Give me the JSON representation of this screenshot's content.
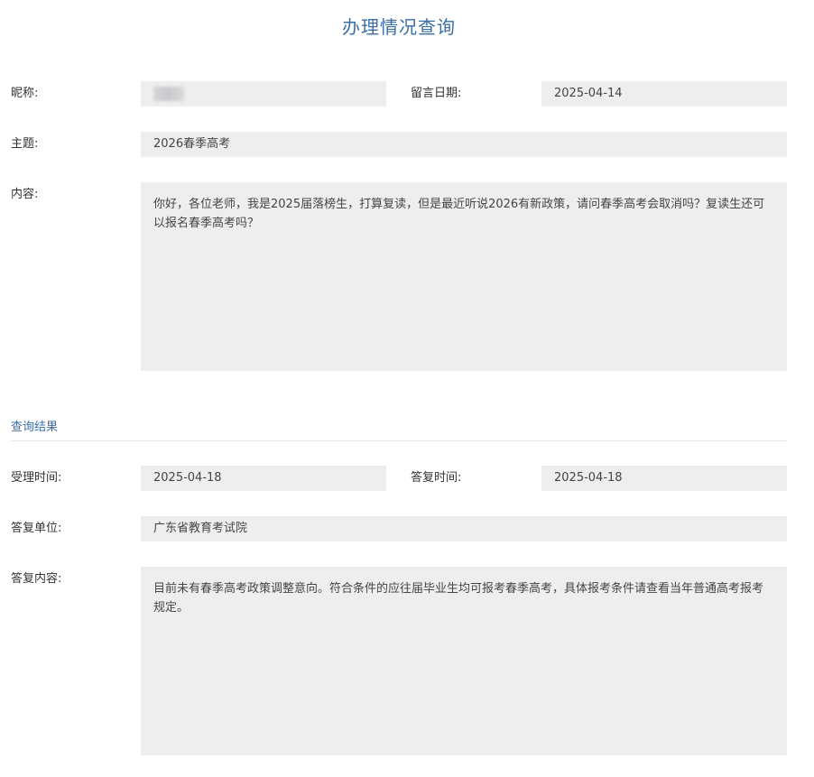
{
  "page": {
    "title": "办理情况查询"
  },
  "message": {
    "nickname_label": "昵称:",
    "nickname_value": "",
    "date_label": "留言日期:",
    "date_value": "2025-04-14",
    "subject_label": "主题:",
    "subject_value": "2026春季高考",
    "content_label": "内容:",
    "content_value": "你好，各位老师，我是2025届落榜生，打算复读，但是最近听说2026有新政策，请问春季高考会取消吗？复读生还可以报名春季高考吗？"
  },
  "result": {
    "section_title": "查询结果",
    "accept_time_label": "受理时间:",
    "accept_time_value": "2025-04-18",
    "reply_time_label": "答复时间:",
    "reply_time_value": "2025-04-18",
    "reply_unit_label": "答复单位:",
    "reply_unit_value": "广东省教育考试院",
    "reply_content_label": "答复内容:",
    "reply_content_value": "目前未有春季高考政策调整意向。符合条件的应往届毕业生均可报考春季高考，具体报考条件请查看当年普通高考报考规定。"
  }
}
